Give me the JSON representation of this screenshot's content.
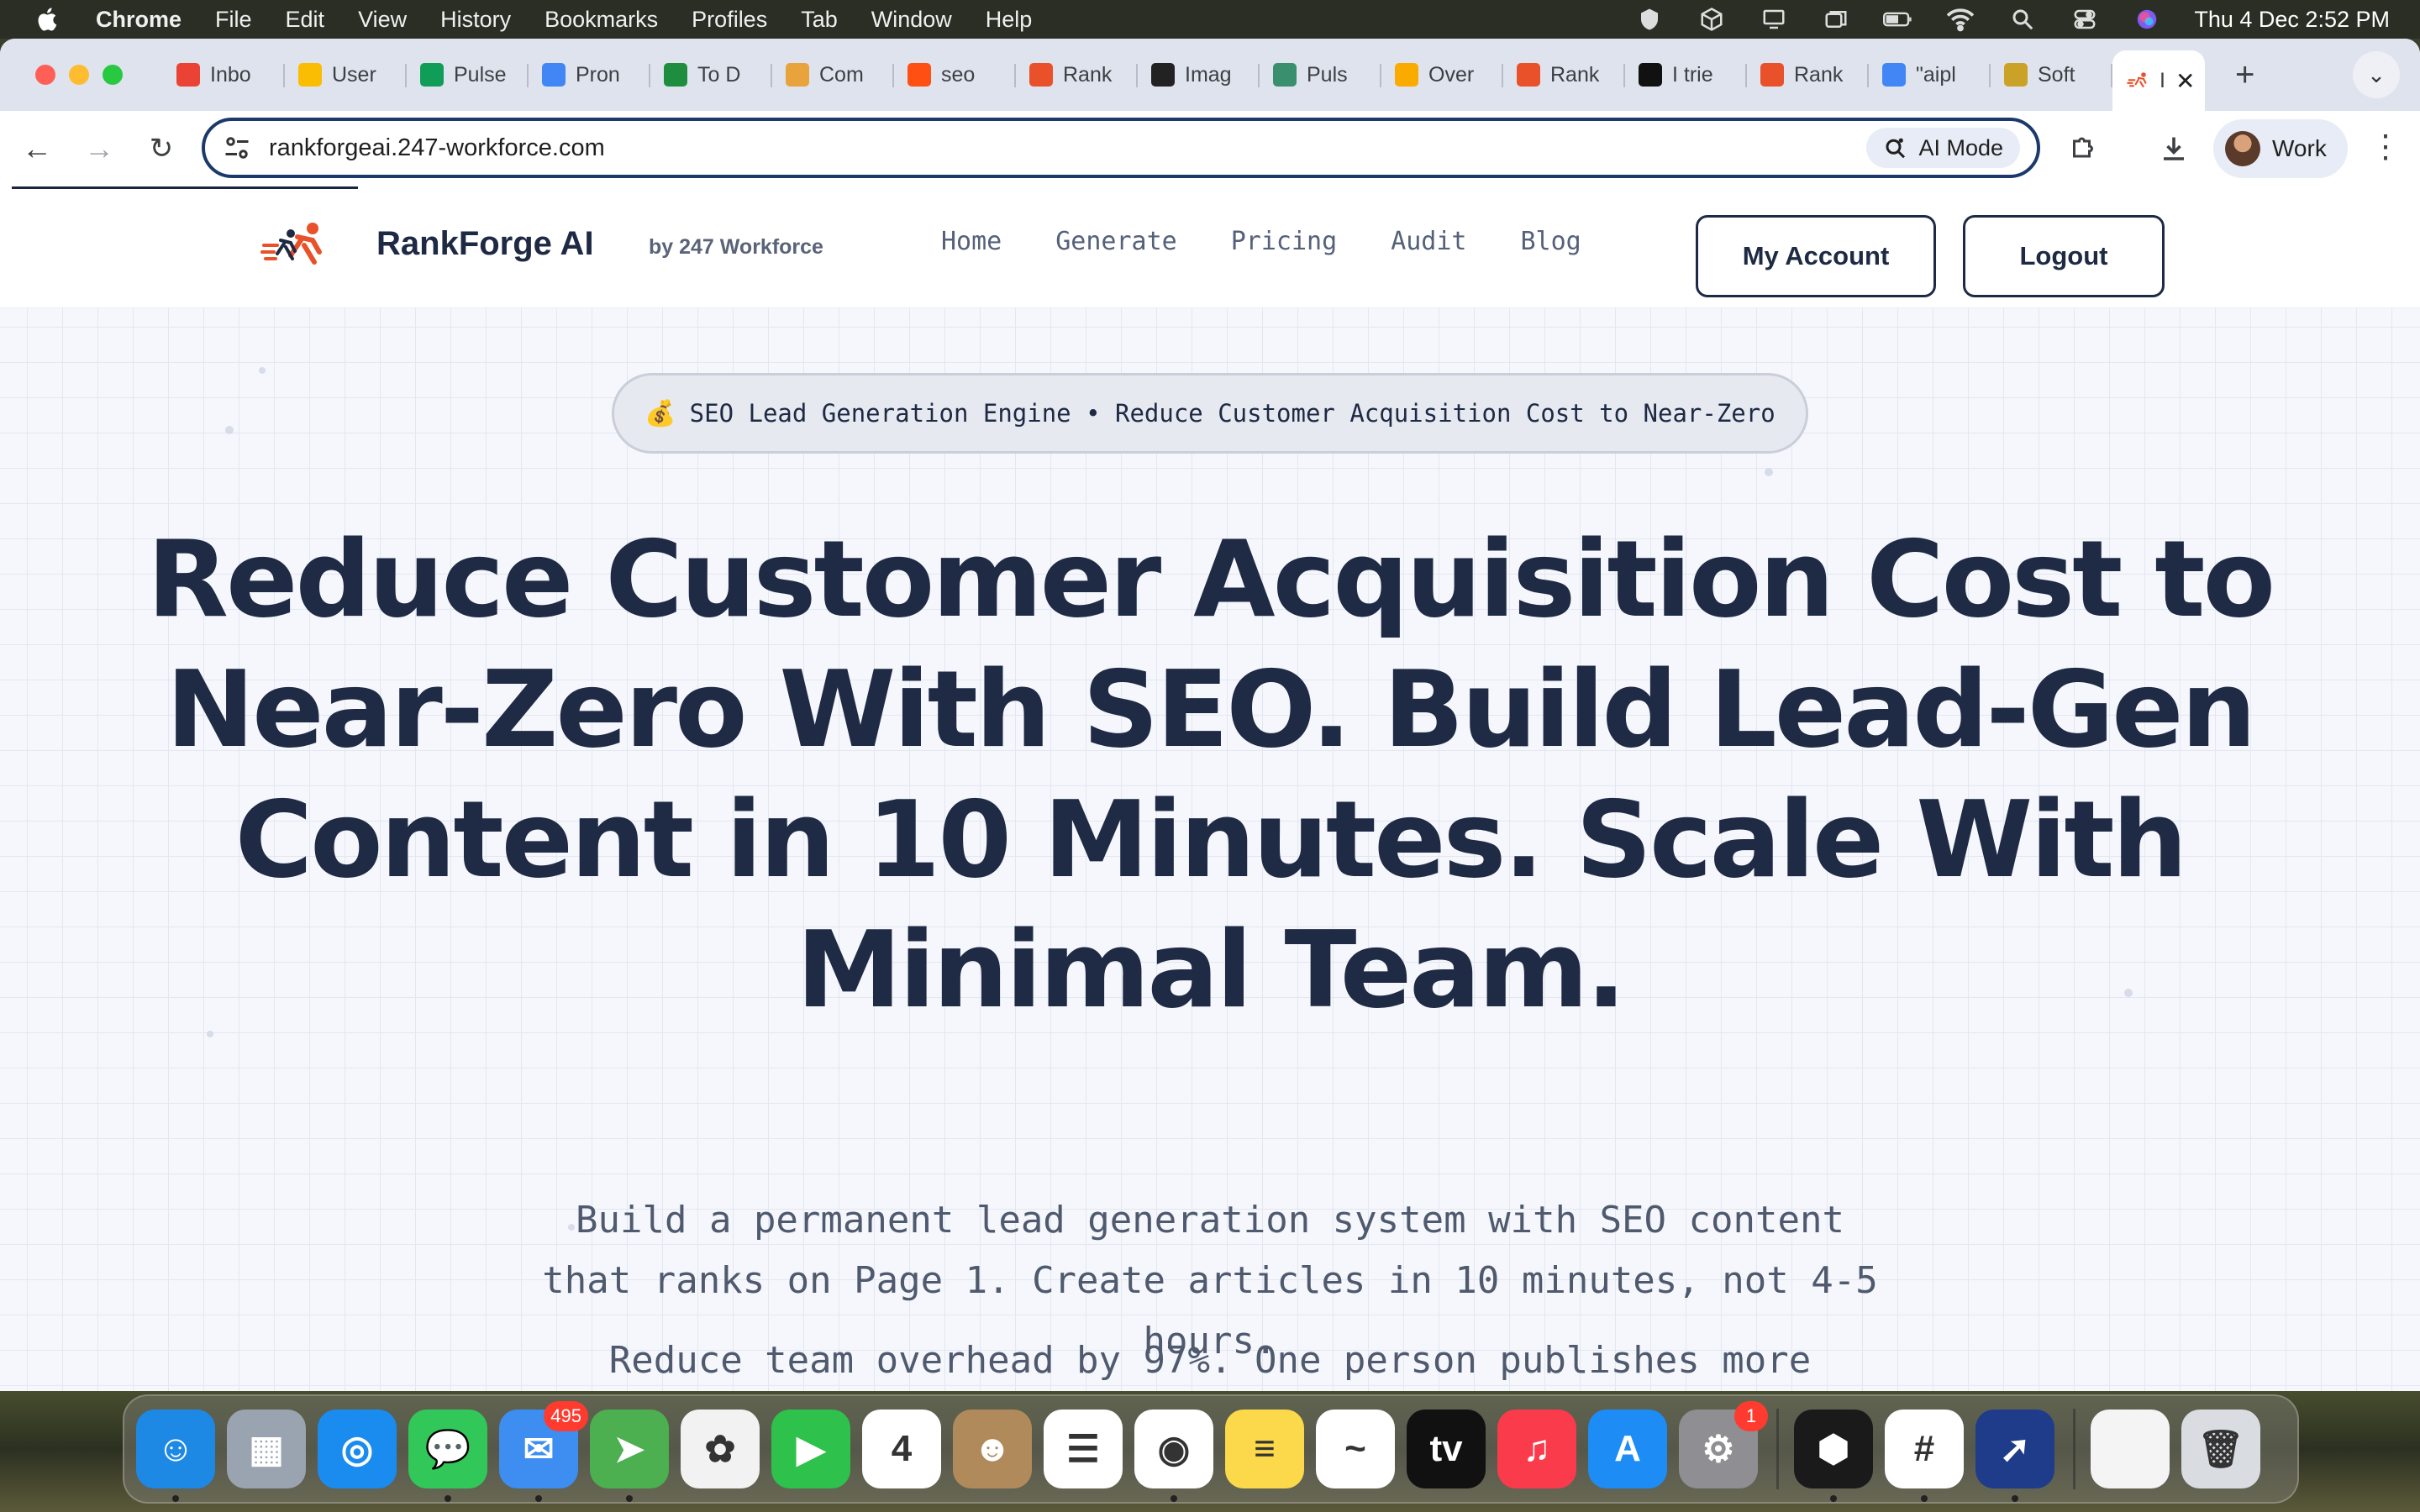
{
  "menubar": {
    "app_name": "Chrome",
    "menus": [
      "File",
      "Edit",
      "View",
      "History",
      "Bookmarks",
      "Profiles",
      "Tab",
      "Window",
      "Help"
    ],
    "clock": "Thu 4 Dec  2:52 PM"
  },
  "browser": {
    "tabs": [
      {
        "label": "Inbo",
        "icon": "gmail-icon",
        "color": "#ea4335"
      },
      {
        "label": "User",
        "icon": "google-ads-icon",
        "color": "#fbbc04"
      },
      {
        "label": "Pulse",
        "icon": "sheets-icon",
        "color": "#0f9d58"
      },
      {
        "label": "Pron",
        "icon": "docs-icon",
        "color": "#4285f4"
      },
      {
        "label": "To D",
        "icon": "checklist-icon",
        "color": "#1e8e3e"
      },
      {
        "label": "Com",
        "icon": "image-icon",
        "color": "#e8a33d"
      },
      {
        "label": "seo",
        "icon": "semrush-icon",
        "color": "#ff4f12"
      },
      {
        "label": "Rank",
        "icon": "rankforge-icon",
        "color": "#e8512a"
      },
      {
        "label": "Imag",
        "icon": "openai-icon",
        "color": "#222222"
      },
      {
        "label": "Puls",
        "icon": "map-icon",
        "color": "#3a8f6e"
      },
      {
        "label": "Over",
        "icon": "analytics-icon",
        "color": "#f9ab00"
      },
      {
        "label": "Rank",
        "icon": "rankforge-icon",
        "color": "#e8512a"
      },
      {
        "label": "I trie",
        "icon": "e-icon",
        "color": "#111111"
      },
      {
        "label": "Rank",
        "icon": "rank-red-icon",
        "color": "#e8512a"
      },
      {
        "label": "\"aipl",
        "icon": "google-icon",
        "color": "#4285f4"
      },
      {
        "label": "Soft",
        "icon": "shield-icon",
        "color": "#c9a227"
      }
    ],
    "active_tab": {
      "label": "I",
      "icon": "rankforge-icon"
    },
    "url": "rankforgeai.247-workforce.com",
    "ai_mode_label": "AI Mode",
    "profile_label": "Work"
  },
  "site": {
    "brand": "RankForge AI",
    "brand_sub": "by 247 Workforce",
    "nav": [
      "Home",
      "Generate",
      "Pricing",
      "Audit",
      "Blog"
    ],
    "my_account": "My Account",
    "logout": "Logout",
    "badge_icon": "💰",
    "badge_text": "SEO Lead Generation Engine • Reduce Customer Acquisition Cost to Near-Zero",
    "headline": "Reduce Customer Acquisition Cost to Near-Zero With SEO. Build Lead-Gen Content in 10 Minutes. Scale With Minimal Team.",
    "subheadline": "Build a permanent lead generation system with SEO content that ranks on Page 1. Create articles in 10 minutes, not 4-5 hours.",
    "subheadline2": "Reduce team overhead by 97%. One person publishes more"
  },
  "dock": {
    "apps": [
      {
        "name": "finder",
        "color": "#1e88e5",
        "glyph": "☺",
        "running": true
      },
      {
        "name": "launchpad",
        "color": "#9aa3b0",
        "glyph": "▦",
        "running": false
      },
      {
        "name": "safari",
        "color": "#1a8cf0",
        "glyph": "◎",
        "running": false
      },
      {
        "name": "messages",
        "color": "#32c759",
        "glyph": "💬",
        "running": true
      },
      {
        "name": "mail",
        "color": "#3d8ef0",
        "glyph": "✉",
        "running": true,
        "badge": "495"
      },
      {
        "name": "maps",
        "color": "#4caf50",
        "glyph": "➤",
        "running": true
      },
      {
        "name": "photos",
        "color": "#f2f2f2",
        "glyph": "✿",
        "running": false
      },
      {
        "name": "facetime",
        "color": "#2ec14c",
        "glyph": "▶",
        "running": false
      },
      {
        "name": "calendar",
        "color": "#ffffff",
        "glyph": "4",
        "running": false
      },
      {
        "name": "contacts",
        "color": "#b08a5a",
        "glyph": "☻",
        "running": false
      },
      {
        "name": "reminders",
        "color": "#ffffff",
        "glyph": "☰",
        "running": false
      },
      {
        "name": "chrome",
        "color": "#ffffff",
        "glyph": "◉",
        "running": true
      },
      {
        "name": "notes",
        "color": "#fbd94a",
        "glyph": "≡",
        "running": false
      },
      {
        "name": "freeform",
        "color": "#ffffff",
        "glyph": "~",
        "running": false
      },
      {
        "name": "apple-tv",
        "color": "#111111",
        "glyph": "tv",
        "running": false
      },
      {
        "name": "music",
        "color": "#fa3b4c",
        "glyph": "♫",
        "running": false
      },
      {
        "name": "app-store",
        "color": "#1d8cf5",
        "glyph": "A",
        "running": false
      },
      {
        "name": "system-settings",
        "color": "#8e8e93",
        "glyph": "⚙",
        "running": false,
        "badge": "1"
      },
      {
        "name": "cube-app",
        "color": "#1a1a1a",
        "glyph": "⬢",
        "running": true
      },
      {
        "name": "slack",
        "color": "#ffffff",
        "glyph": "#",
        "running": true
      },
      {
        "name": "copilot-app",
        "color": "#1f3c8a",
        "glyph": "➚",
        "running": true
      },
      {
        "name": "rankforge-app",
        "color": "#f4f4f4",
        "glyph": "",
        "running": false
      },
      {
        "name": "trash",
        "color": "#d9dde2",
        "glyph": "🗑",
        "running": false
      }
    ]
  }
}
